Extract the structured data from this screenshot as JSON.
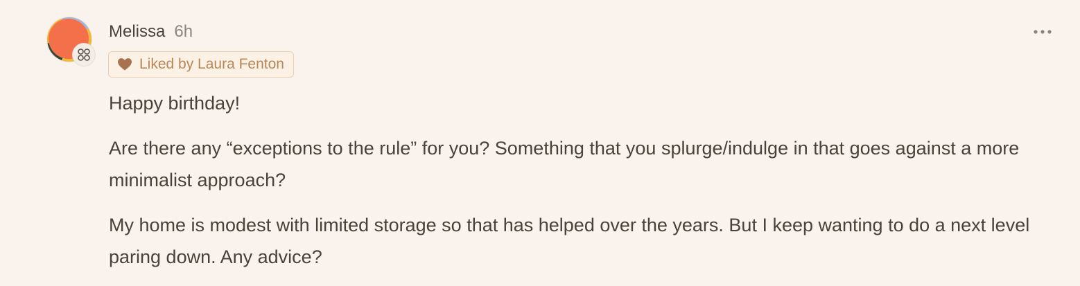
{
  "comment": {
    "author": "Melissa",
    "timestamp": "6h",
    "liked_by": "Liked by Laura Fenton",
    "paragraphs": [
      "Happy birthday!",
      "Are there any “exceptions to the rule” for you? Something that you splurge/indulge in that goes against a more minimalist approach?",
      "My home is modest with limited storage so that has helped over the years. But I keep wanting to do a next level paring down. Any advice?"
    ]
  },
  "icons": {
    "avatar": "avatar-image",
    "badge": "subscriber-badge-icon",
    "heart": "heart-icon",
    "more": "more-options-icon"
  },
  "colors": {
    "background": "#faf2ec",
    "text": "#4a4238",
    "muted": "#8d857c",
    "like_accent": "#b98658",
    "heart": "#a7724e"
  }
}
